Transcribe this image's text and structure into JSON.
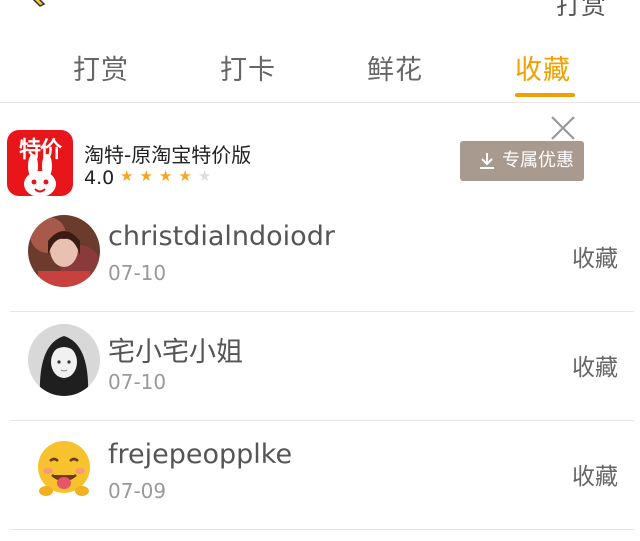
{
  "top": {
    "right_text": "打赏"
  },
  "tabs": [
    {
      "label": "打赏",
      "active": false
    },
    {
      "label": "打卡",
      "active": false
    },
    {
      "label": "鲜花",
      "active": false
    },
    {
      "label": "收藏",
      "active": true
    }
  ],
  "accent_color": "#f0a000",
  "ad": {
    "logo_text": "特价",
    "title": "淘特-原淘宝特价版",
    "rating": "4.0",
    "stars_filled": 4,
    "stars_total": 5,
    "button_label": "专属优惠"
  },
  "list": [
    {
      "name": "christdialndoiodr",
      "date": "07-10",
      "action": "收藏",
      "avatar": "photo-avatar"
    },
    {
      "name": "宅小宅小姐",
      "date": "07-10",
      "action": "收藏",
      "avatar": "girl-avatar"
    },
    {
      "name": "frejepeopplke",
      "date": "07-09",
      "action": "收藏",
      "avatar": "emoji-avatar"
    }
  ]
}
